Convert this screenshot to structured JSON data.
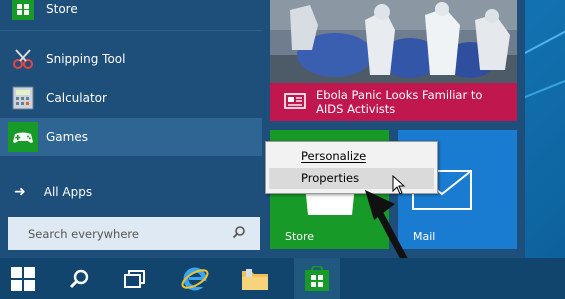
{
  "left_pane": {
    "items": [
      {
        "label": "Store",
        "icon": "store-icon"
      },
      {
        "label": "Snipping Tool",
        "icon": "snipping-tool-icon"
      },
      {
        "label": "Calculator",
        "icon": "calculator-icon"
      },
      {
        "label": "Games",
        "icon": "games-icon"
      }
    ],
    "all_apps": "All Apps",
    "search_placeholder": "Search everywhere"
  },
  "tiles": {
    "news_caption_line1": "Ebola Panic Looks Familiar to",
    "news_caption_line2": "AIDS Activists",
    "store_label": "Store",
    "mail_label": "Mail"
  },
  "context_menu": {
    "items": [
      {
        "label": "Personalize",
        "mnemonic": "P"
      },
      {
        "label": "Properties",
        "mnemonic": "P"
      }
    ]
  },
  "colors": {
    "news_caption": "#c0174f",
    "store_tile": "#189a28",
    "mail_tile": "#1a7cd0",
    "start_background": "#1e4e7a",
    "taskbar": "#12456e"
  }
}
